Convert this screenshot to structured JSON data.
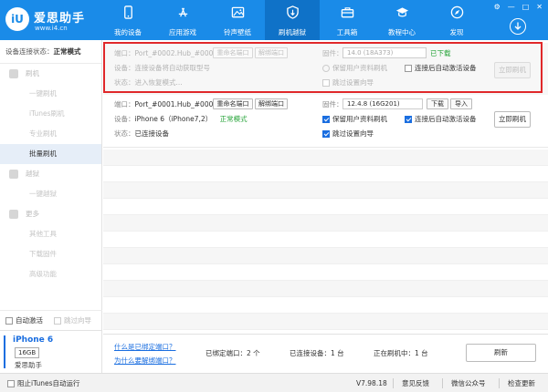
{
  "header": {
    "logo_badge": "iU",
    "logo_title": "爱思助手",
    "logo_url": "www.i4.cn",
    "nav": [
      {
        "label": "我的设备",
        "icon": "phone-icon",
        "active": false
      },
      {
        "label": "应用游戏",
        "icon": "app-store-icon",
        "active": false
      },
      {
        "label": "铃声壁纸",
        "icon": "image-icon",
        "active": false
      },
      {
        "label": "刷机越狱",
        "icon": "shield-icon",
        "active": true
      },
      {
        "label": "工具箱",
        "icon": "toolbox-icon",
        "active": false
      },
      {
        "label": "教程中心",
        "icon": "graduation-cap-icon",
        "active": false
      },
      {
        "label": "发现",
        "icon": "compass-icon",
        "active": false
      }
    ],
    "window_controls": [
      "⚙",
      "—",
      "□",
      "✕"
    ]
  },
  "sidebar": {
    "status_label": "设备连接状态：",
    "status_value": "正常模式",
    "sections": [
      {
        "label": "刷机",
        "items": [
          "一键刷机",
          "iTunes刷机",
          "专业刷机",
          "批量刷机"
        ],
        "active_item": 3
      },
      {
        "label": "越狱",
        "items": [
          "一键越狱"
        ]
      },
      {
        "label": "更多",
        "items": [
          "其他工具",
          "下载固件",
          "高级功能"
        ]
      }
    ],
    "auto_activate": "自动激活",
    "skip_guide": "跳过向导"
  },
  "device": {
    "name": "iPhone 6",
    "storage": "16GB",
    "subtitle": "爱思助手"
  },
  "ports": [
    {
      "port_label": "端口：",
      "port_value": "Port_#0002.Hub_#0003",
      "rename": "重命名端口",
      "unbind": "解绑端口",
      "device_label": "设备：",
      "device_value": "连接设备将自动获取型号",
      "mode": "",
      "state_label": "状态：",
      "state_value": "进入恢复模式...",
      "firmware_label": "固件：",
      "firmware_value": "14.0 (18A373)",
      "firmware_status": "已下载",
      "keep_data": "保留用户资料刷机",
      "auto_activate": "连接后自动激活设备",
      "skip_setup": "跳过设置向导",
      "flash": "立即刷机"
    },
    {
      "port_label": "端口：",
      "port_value": "Port_#0001.Hub_#0003",
      "rename": "重命名端口",
      "unbind": "解绑端口",
      "device_label": "设备：",
      "device_value": "iPhone 6（iPhone7,2）",
      "mode": "正常模式",
      "state_label": "状态：",
      "state_value": "已连接设备",
      "firmware_label": "固件：",
      "firmware_value": "12.4.8 (16G201)",
      "download": "下载",
      "import": "导入",
      "keep_data": "保留用户资料刷机",
      "auto_activate": "连接后自动激活设备",
      "skip_setup": "跳过设置向导",
      "flash": "立即刷机"
    }
  ],
  "footer": {
    "link1": "什么是已绑定端口？",
    "link2": "为什么要解绑端口？",
    "bound_ports": "已绑定端口：2 个",
    "connected": "已连接设备：1 台",
    "flashing": "正在刷机中：1 台",
    "refresh": "刷新"
  },
  "statusbar": {
    "block_itunes": "阻止iTunes自动运行",
    "version": "V7.98.18",
    "feedback": "意见反馈",
    "wechat": "微信公众号",
    "update": "检查更新"
  },
  "colors": {
    "header": "#1a8be8",
    "nav_active": "#0f72c8",
    "accent": "#1a6ee0",
    "green": "#27a43a",
    "highlight": "#e0282a"
  }
}
